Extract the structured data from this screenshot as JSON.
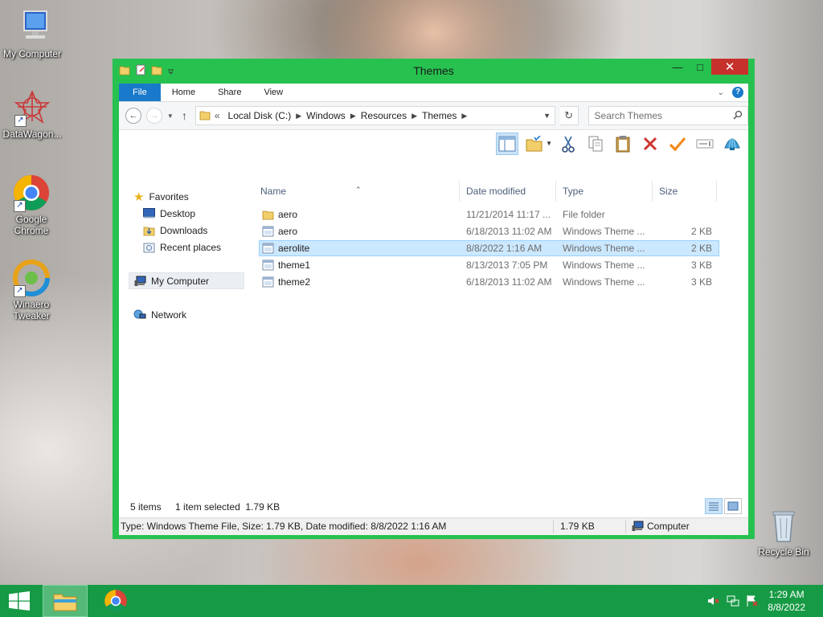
{
  "desktop": {
    "icons": [
      {
        "label": "My Computer",
        "icon": "computer-icon"
      },
      {
        "label": "DataWagon...",
        "icon": "datawagon-icon"
      },
      {
        "label_lines": [
          "Google",
          "Chrome"
        ],
        "icon": "chrome-icon"
      },
      {
        "label_lines": [
          "Winaero",
          "Tweaker"
        ],
        "icon": "winaero-icon"
      },
      {
        "label": "Recycle Bin",
        "icon": "recycle-bin-icon"
      }
    ]
  },
  "window": {
    "title": "Themes",
    "accent_color": "#27c14f",
    "close_color": "#c7312c",
    "ribbon_tabs": [
      "File",
      "Home",
      "Share",
      "View"
    ],
    "address": {
      "prefix": "«",
      "crumbs": [
        "Local Disk (C:)",
        "Windows",
        "Resources",
        "Themes"
      ]
    },
    "search": {
      "placeholder": "Search Themes"
    },
    "nav": {
      "favorites": "Favorites",
      "favorites_items": [
        "Desktop",
        "Downloads",
        "Recent places"
      ],
      "computer": "My Computer",
      "network": "Network"
    },
    "columns": [
      "Name",
      "Date modified",
      "Type",
      "Size"
    ],
    "files": [
      {
        "name": "aero",
        "date": "11/21/2014 11:17 ...",
        "type": "File folder",
        "size": "",
        "icon": "folder-icon",
        "selected": false
      },
      {
        "name": "aero",
        "date": "6/18/2013 11:02 AM",
        "type": "Windows Theme ...",
        "size": "2 KB",
        "icon": "theme-file-icon",
        "selected": false
      },
      {
        "name": "aerolite",
        "date": "8/8/2022 1:16 AM",
        "type": "Windows Theme ...",
        "size": "2 KB",
        "icon": "theme-file-icon",
        "selected": true
      },
      {
        "name": "theme1",
        "date": "8/13/2013 7:05 PM",
        "type": "Windows Theme ...",
        "size": "3 KB",
        "icon": "theme-file-icon",
        "selected": false
      },
      {
        "name": "theme2",
        "date": "6/18/2013 11:02 AM",
        "type": "Windows Theme ...",
        "size": "3 KB",
        "icon": "theme-file-icon",
        "selected": false
      }
    ],
    "status": {
      "items_count": "5 items",
      "selection": "1 item selected  1.79 KB",
      "details": "Type: Windows Theme File, Size: 1.79 KB, Date modified: 8/8/2022 1:16 AM",
      "size": "1.79 KB",
      "location": "Computer"
    }
  },
  "taskbar": {
    "color": "#179a45",
    "time": "1:29 AM",
    "date": "8/8/2022"
  }
}
